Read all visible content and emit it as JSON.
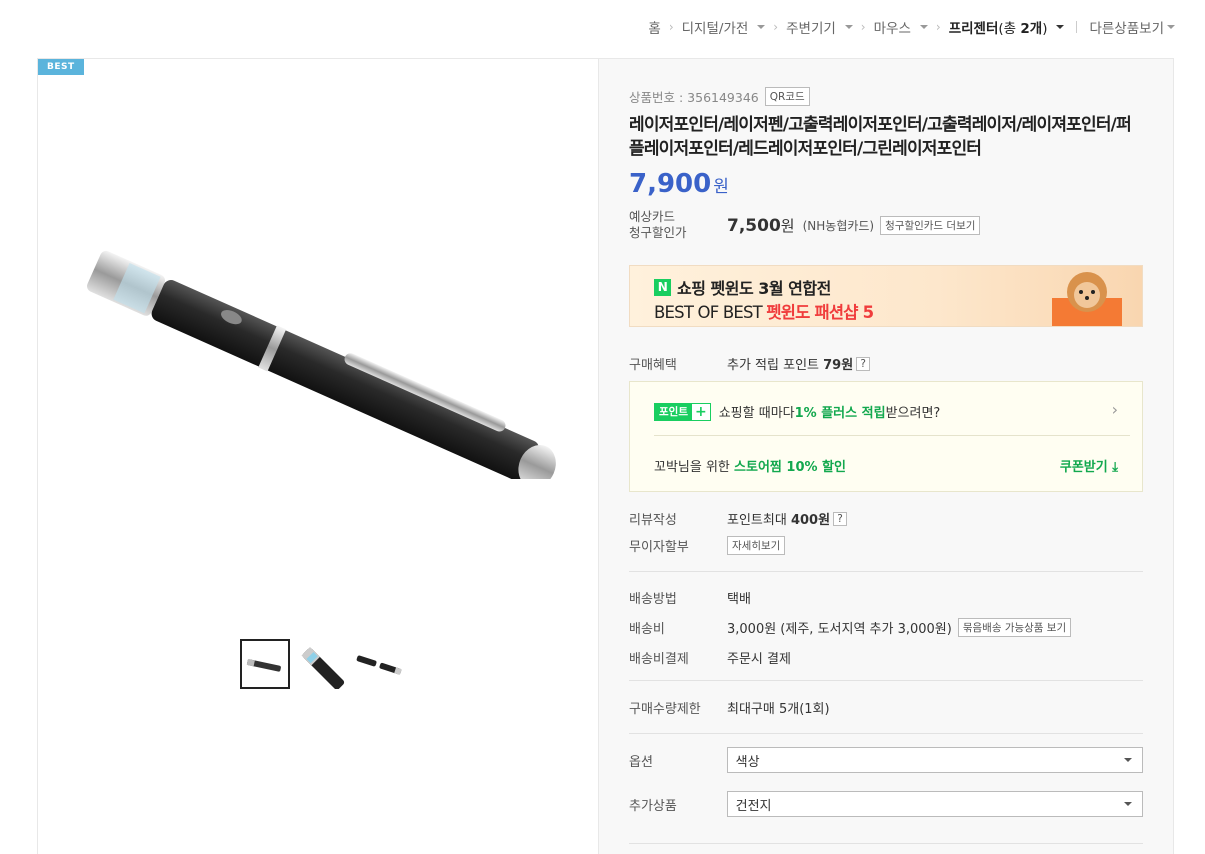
{
  "breadcrumb": {
    "items": [
      "홈",
      "디지털/가전",
      "주변기기",
      "마우스"
    ],
    "current": "프리젠터",
    "count_prefix": "(총 ",
    "count": "2개",
    "count_suffix": ")",
    "other": "다른상품보기"
  },
  "gallery": {
    "badge": "BEST"
  },
  "product": {
    "number_label": "상품번호 : 356149346",
    "qr_label": "QR코드",
    "title": "레이저포인터/레이저펜/고출력레이저포인터/고출력레이저/레이져포인터/퍼플레이저포인터/레드레이저포인터/그린레이저포인터",
    "price": "7,900",
    "price_unit": "원",
    "card_label_1": "예상카드",
    "card_label_2": "청구할인가",
    "card_price": "7,500",
    "card_price_unit": "원",
    "card_name": "(NH농협카드)",
    "card_more": "청구할인카드 더보기"
  },
  "banner": {
    "logo": "N",
    "line1": "쇼핑 펫윈도 3월 연합전",
    "line2_a": "BEST OF BEST ",
    "line2_b": "펫윈도 패션샵 5"
  },
  "benefit": {
    "label": "구매혜택",
    "value_a": "추가 적립 포인트 ",
    "value_b": "79원",
    "q": "?"
  },
  "point_box": {
    "badge_text": "포인트",
    "badge_plus": "+",
    "line1_a": "쇼핑할 때마다 ",
    "line1_b": "1% 플러스 적립",
    "line1_c": " 받으려면?",
    "line2_a": "꼬박님을 위한 ",
    "line2_b": "스토어찜 10% 할인",
    "coupon": "쿠폰받기 ⤓"
  },
  "review": {
    "label": "리뷰작성",
    "value_a": "포인트최대 ",
    "value_b": "400원",
    "q": "?"
  },
  "installment": {
    "label": "무이자할부",
    "button": "자세히보기"
  },
  "shipping": {
    "method_label": "배송방법",
    "method_value": "택배",
    "fee_label": "배송비",
    "fee_value": "3,000원 (제주, 도서지역 추가 3,000원)",
    "fee_button": "묶음배송 가능상품 보기",
    "pay_label": "배송비결제",
    "pay_value": "주문시 결제"
  },
  "limit": {
    "label": "구매수량제한",
    "value": "최대구매 5개(1회)"
  },
  "options": {
    "option_label": "옵션",
    "option_value": "색상",
    "addon_label": "추가상품",
    "addon_value": "건전지"
  },
  "colors": {
    "price_blue": "#3a62c9",
    "naver_green": "#19ce60",
    "best_blue": "#5bb4dc",
    "promo_red": "#f03c3c"
  }
}
